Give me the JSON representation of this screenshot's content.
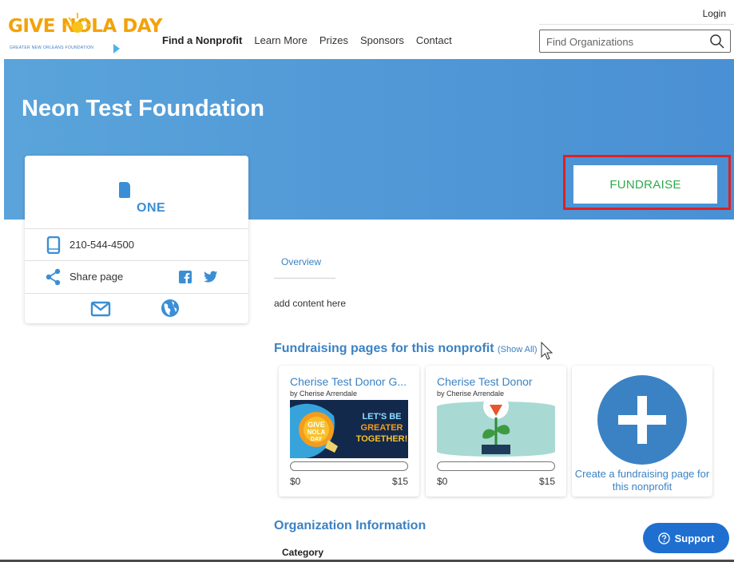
{
  "header": {
    "logo_text": "GIVE NOLA DAY",
    "logo_subtitle": "GREATER NEW ORLEANS FOUNDATION",
    "login_label": "Login",
    "nav": [
      "Find a Nonprofit",
      "Learn More",
      "Prizes",
      "Sponsors",
      "Contact"
    ],
    "search_placeholder": "Find Organizations"
  },
  "hero": {
    "title": "Neon Test Foundation",
    "fundraise_label": "FUNDRAISE"
  },
  "org_card": {
    "logo_text": "ONE",
    "phone": "210-544-4500",
    "share_label": "Share page"
  },
  "main": {
    "tab_overview": "Overview",
    "content_text": "add content here",
    "fundraising_title": "Fundraising pages for this nonprofit",
    "show_all": "(Show All)",
    "pages": [
      {
        "title": "Cherise Test Donor G...",
        "by": "by Cherise Arrendale",
        "raised": "$0",
        "goal": "$15",
        "progress": 0,
        "image_text": [
          "LET'S BE",
          "GREATER",
          "TOGETHER!"
        ]
      },
      {
        "title": "Cherise Test Donor",
        "by": "by Cherise Arrendale",
        "raised": "$0",
        "goal": "$15",
        "progress": 0
      }
    ],
    "create_label": "Create a fundraising page for this nonprofit",
    "org_info_title": "Organization Information",
    "category_label": "Category"
  },
  "support_label": "Support",
  "colors": {
    "brand_orange": "#f2a20a",
    "hero_blue": "#4f97d6",
    "link_blue": "#3b82c4",
    "fundraise_green": "#2eaa4b",
    "highlight_red": "#e02020",
    "support_blue": "#1f6fd1"
  }
}
